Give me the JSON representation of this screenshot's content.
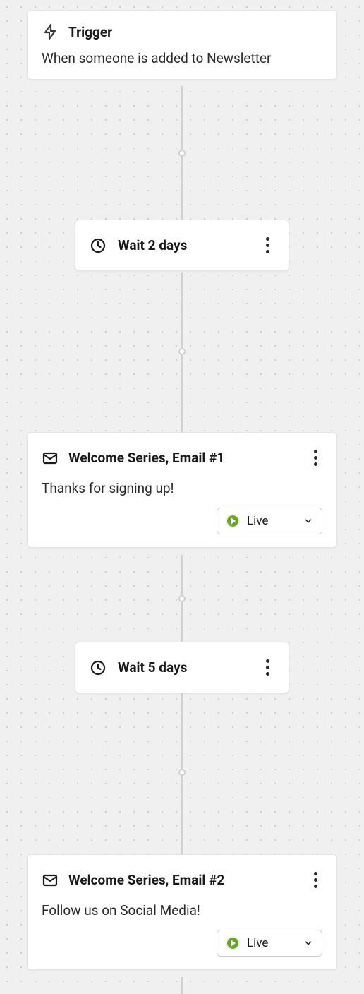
{
  "trigger": {
    "title": "Trigger",
    "description": "When someone is added to Newsletter"
  },
  "wait1": {
    "label": "Wait 2 days"
  },
  "email1": {
    "title": "Welcome Series, Email #1",
    "description": "Thanks for signing up!",
    "status": "Live"
  },
  "wait2": {
    "label": "Wait 5 days"
  },
  "email2": {
    "title": "Welcome Series, Email #2",
    "description": "Follow us on Social Media!",
    "status": "Live"
  }
}
